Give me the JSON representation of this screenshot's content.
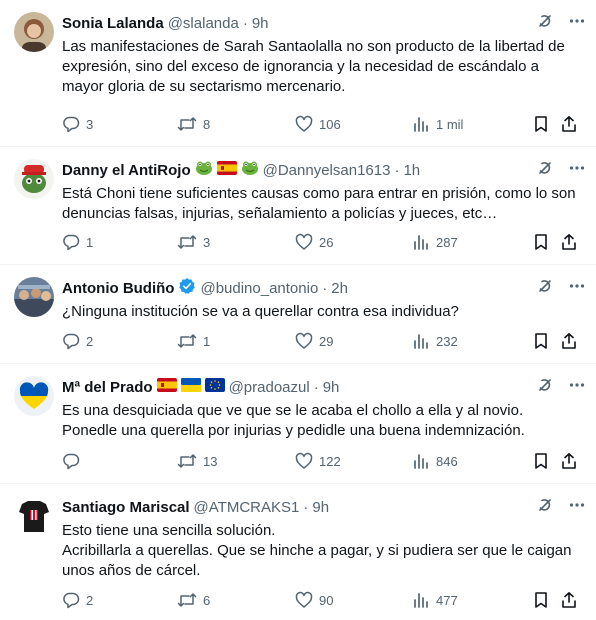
{
  "tweets": [
    {
      "name": "Sonia Lalanda",
      "handle": "@slalanda",
      "sep": "·",
      "time": "9h",
      "flags": [],
      "text": "Las manifestaciones de Sarah Santaolalla no son producto de la libertad de expresión, sino del exceso de ignorancia y la necesidad de escándalo a mayor gloria de su sectarismo mercenario.",
      "replies": "3",
      "retweets": "8",
      "likes": "106",
      "views": "1 mil",
      "verified": false
    },
    {
      "name": "Danny el AntiRojo",
      "handle": "@Dannyelsan1613",
      "sep": "·",
      "time": "1h",
      "flags": [
        "frog-emoji",
        "spain-flag",
        "frog-emoji"
      ],
      "text": "Está Choni tiene suficientes causas como para entrar en prisión, como lo son denuncias falsas, injurias, señalamiento a policías y jueces, etc…",
      "replies": "1",
      "retweets": "3",
      "likes": "26",
      "views": "287",
      "verified": false
    },
    {
      "name": "Antonio Budiño",
      "handle": "@budino_antonio",
      "sep": "·",
      "time": "2h",
      "flags": [],
      "text": "¿Ninguna institución se va a querellar contra esa individua?",
      "replies": "2",
      "retweets": "1",
      "likes": "29",
      "views": "232",
      "verified": true
    },
    {
      "name": "Mª del Prado",
      "handle": "@pradoazul",
      "sep": "·",
      "time": "9h",
      "flags": [
        "spain-flag",
        "ukraine-flag",
        "eu-flag"
      ],
      "text": "Es una desquiciada que ve que se le acaba el chollo a ella y al novio. Ponedle una querella por injurias y pedidle una buena indemnización.",
      "replies": "",
      "retweets": "13",
      "likes": "122",
      "views": "846",
      "verified": false
    },
    {
      "name": "Santiago Mariscal",
      "handle": "@ATMCRAKS1",
      "sep": "·",
      "time": "9h",
      "flags": [],
      "text": "Esto tiene una sencilla solución.\nAcribillarla a querellas. Que se hinche a pagar, y si pudiera ser que le caigan unos años de cárcel.",
      "replies": "2",
      "retweets": "6",
      "likes": "90",
      "views": "477",
      "verified": false
    }
  ],
  "colors": {
    "text": "#0f1419",
    "secondary": "#536471",
    "verified": "#1d9bf0",
    "divider": "#eff3f4"
  }
}
